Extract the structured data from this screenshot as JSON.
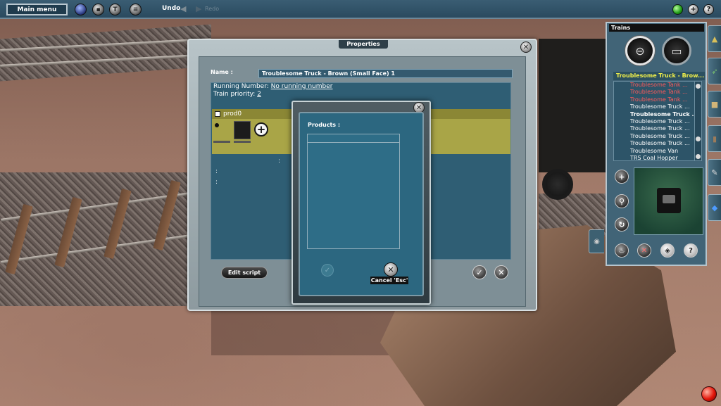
{
  "toolbar": {
    "main_menu": "Main menu",
    "undo": "Undo",
    "redo": "Redo",
    "right_plus": "+",
    "right_help": "?"
  },
  "properties_dialog": {
    "title": "Properties",
    "name_label": "Name :",
    "name_value": "Troublesome Truck - Brown (Small Face) 1",
    "running_number_label": "Running Number:",
    "running_number_value": "No running number",
    "train_priority_label": "Train priority:",
    "train_priority_value": "2",
    "product_group": "prod0",
    "edit_script": "Edit script",
    "colons": [
      ":",
      ":",
      ":"
    ]
  },
  "products_dialog": {
    "label": "Products :",
    "cancel_label": "Cancel 'Esc'"
  },
  "trains_panel": {
    "title": "Trains",
    "selected": "Troublesome Truck - Brow...",
    "items": [
      {
        "label": "Troublesome Tank ...",
        "color": "red"
      },
      {
        "label": "Troublesome Tank ...",
        "color": "red"
      },
      {
        "label": "Troublesome Tank ...",
        "color": "red"
      },
      {
        "label": "Troublesome Truck ...",
        "color": "white"
      },
      {
        "label": "Troublesome Truck ...",
        "color": "white",
        "bold": true
      },
      {
        "label": "Troublesome Truck ...",
        "color": "white"
      },
      {
        "label": "Troublesome Truck ...",
        "color": "white"
      },
      {
        "label": "Troublesome Truck ...",
        "color": "white"
      },
      {
        "label": "Troublesome Truck ...",
        "color": "white"
      },
      {
        "label": "Troublesome Van",
        "color": "white"
      },
      {
        "label": "TRS Coal Hopper",
        "color": "white"
      }
    ]
  }
}
